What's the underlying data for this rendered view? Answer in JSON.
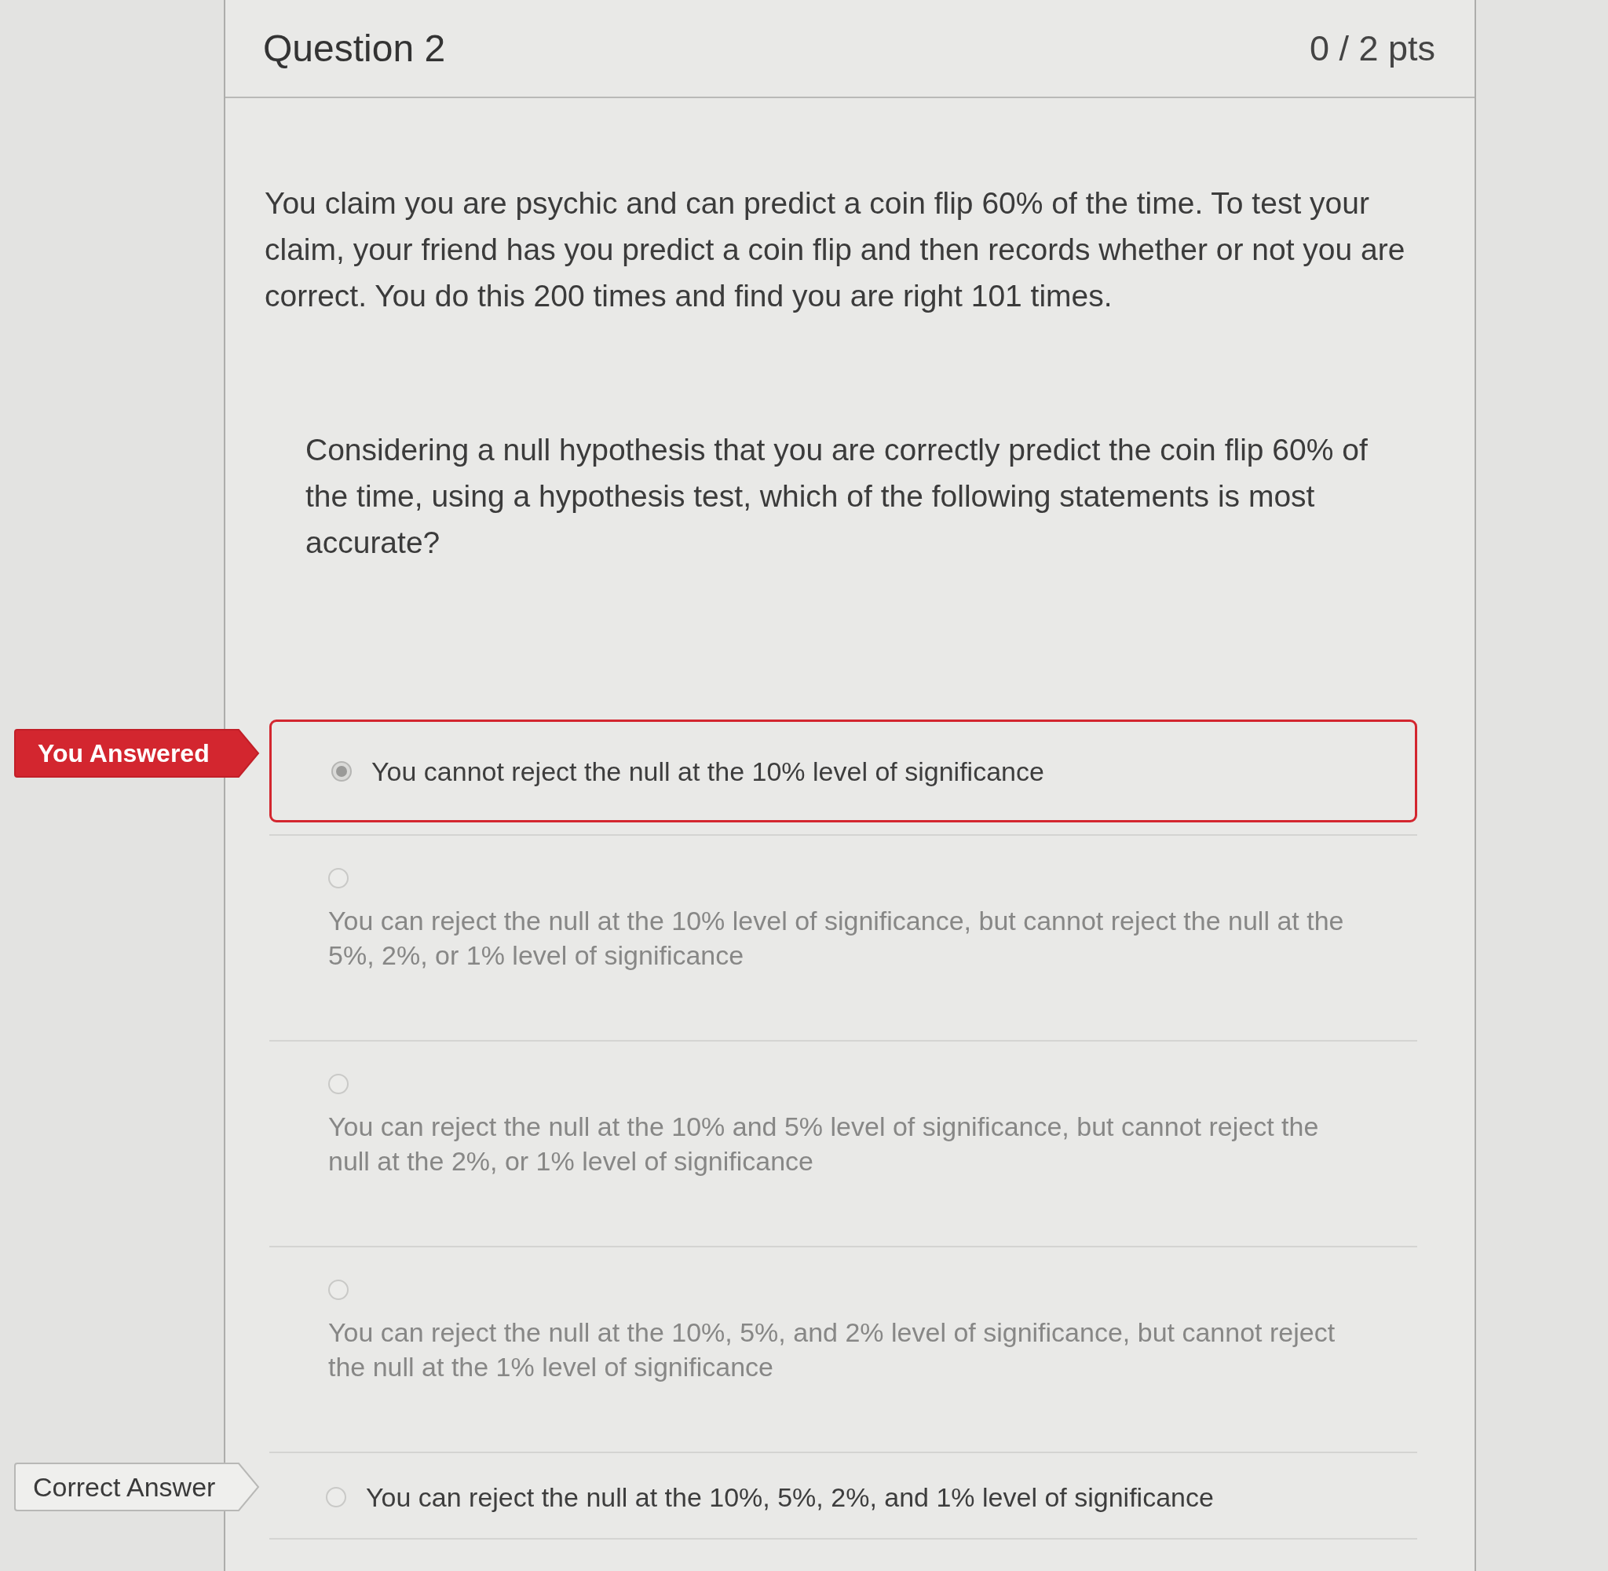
{
  "question": {
    "title": "Question 2",
    "points": "0 / 2 pts"
  },
  "paragraphs": [
    {
      "kind": "statement",
      "text": "You claim you are psychic and can predict a coin flip 60% of the time. To test your claim, your friend has you predict a coin flip and then records whether or not you are correct. You do this 200 times and find you are right 101 times."
    },
    {
      "kind": "prompt",
      "text": "Considering a null hypothesis that you are correctly predict the coin flip 60% of the time, using a hypothesis test, which of the following statements is most accurate?"
    }
  ],
  "answers": [
    {
      "text": "You cannot reject the null at the 10% level of significance",
      "selected": true,
      "label": {
        "kind": "you_answered",
        "text": "You Answered"
      }
    },
    {
      "text": "You can reject the null at the 10% level of significance, but cannot reject the null at the 5%, 2%, or 1% level of significance",
      "selected": false
    },
    {
      "text": "You can reject the null at the 10% and 5% level of significance, but cannot reject the null at the 2%, or 1% level of significance",
      "selected": false
    },
    {
      "text": "You can reject the null at the 10%, 5%, and 2% level of significance, but cannot reject the null at the 1% level of significance",
      "selected": false
    },
    {
      "text": "You can reject the null at the 10%, 5%, 2%, and 1% level of significance",
      "selected": false,
      "label": {
        "kind": "correct",
        "text": "Correct Answer"
      }
    }
  ]
}
